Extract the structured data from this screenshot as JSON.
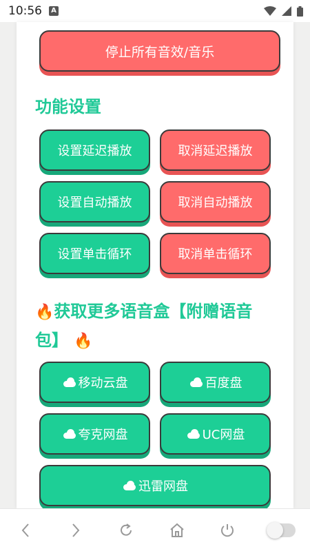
{
  "status_bar": {
    "time": "10:56",
    "notification_badge": "A",
    "icons": [
      "wifi-icon",
      "signal-icon",
      "battery-icon"
    ]
  },
  "buttons": {
    "stop_all": "停止所有音效/音乐",
    "set_delay": "设置延迟播放",
    "cancel_delay": "取消延迟播放",
    "set_auto": "设置自动播放",
    "cancel_auto": "取消自动播放",
    "set_loop": "设置单击循环",
    "cancel_loop": "取消单击循环"
  },
  "sections": {
    "settings_title": "功能设置",
    "more_title_line1": "获取更多语音盒【附赠语音",
    "more_title_line2": "包】"
  },
  "cloud_links": {
    "yidong": "移动云盘",
    "baidu": "百度盘",
    "kuake": "夸克网盘",
    "uc": "UC网盘",
    "xunlei": "迅雷网盘"
  },
  "colors": {
    "green": "#1dcf96",
    "red": "#ff6b6b",
    "title_green": "#20c997"
  },
  "nav_bar": [
    "back-icon",
    "forward-icon",
    "refresh-icon",
    "home-icon",
    "power-icon",
    "toggle-switch"
  ]
}
